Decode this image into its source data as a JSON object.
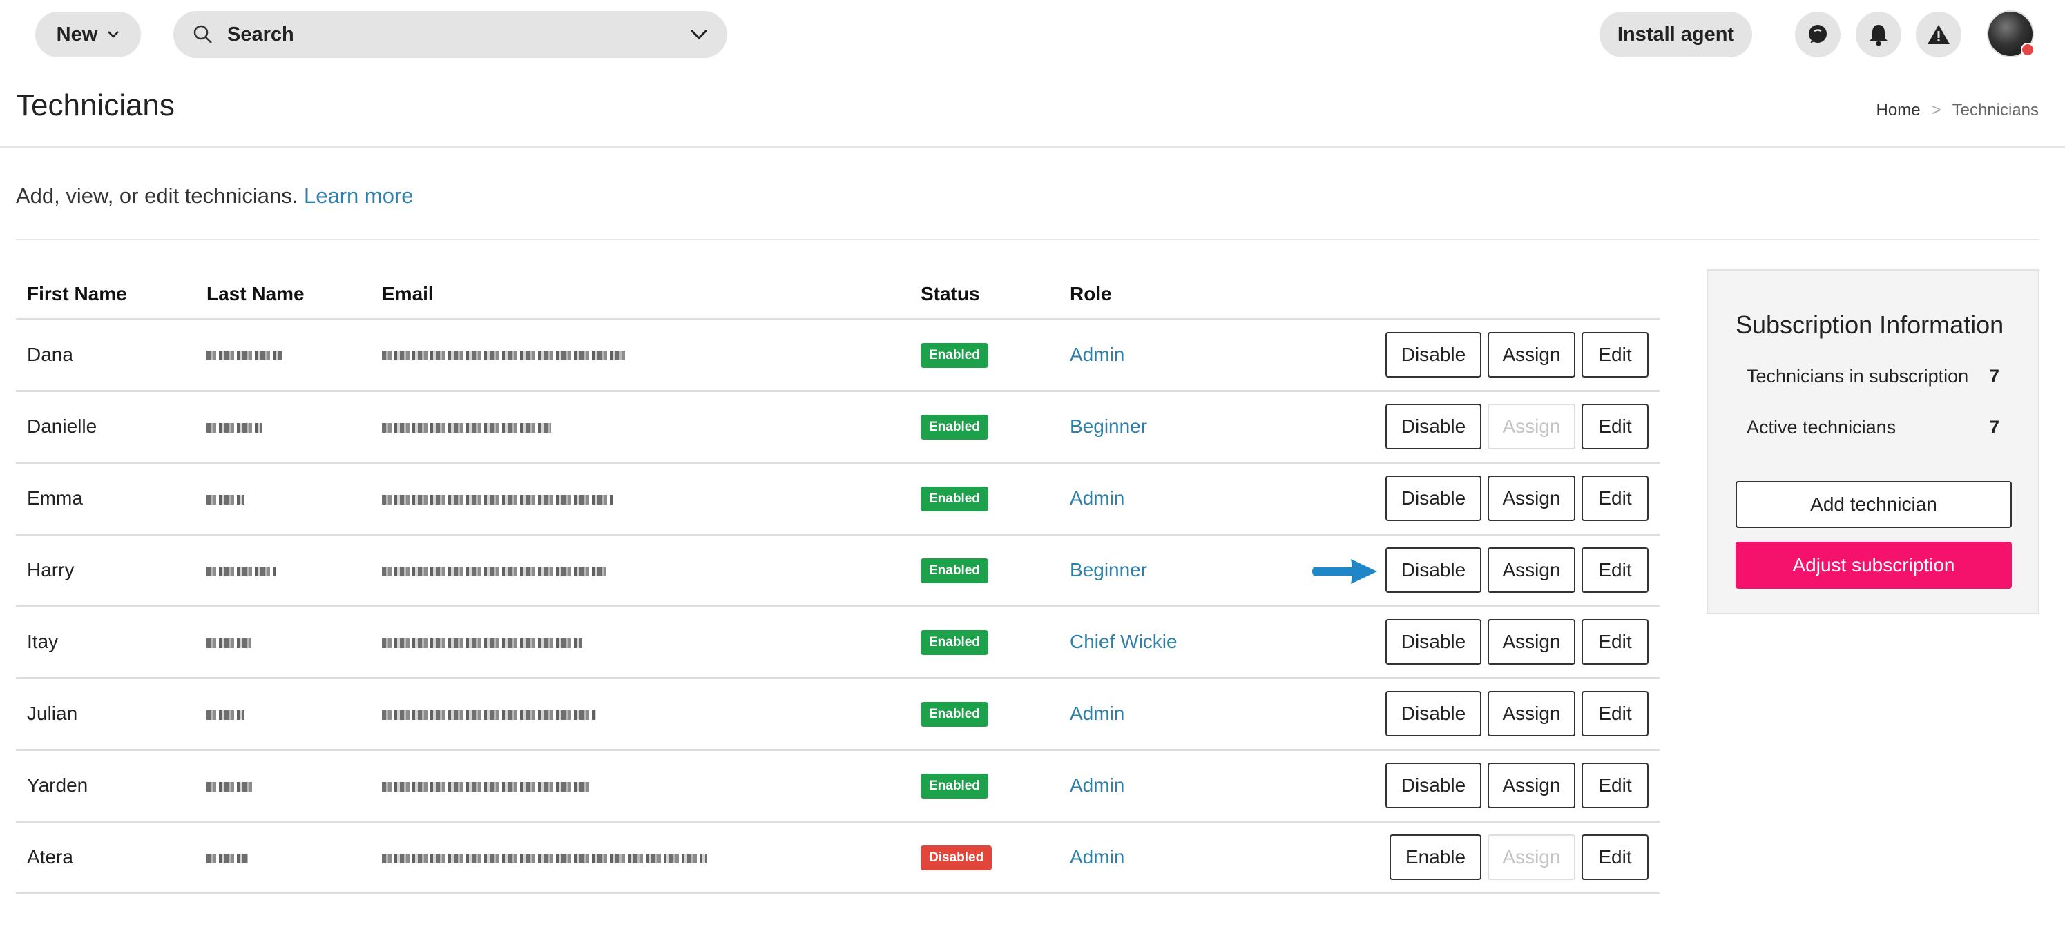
{
  "topbar": {
    "new_label": "New",
    "search_label": "Search",
    "install_label": "Install agent",
    "icons": [
      "chat-icon",
      "bell-icon",
      "alert-icon"
    ]
  },
  "page": {
    "title": "Technicians",
    "breadcrumb": {
      "home": "Home",
      "separator": ">",
      "current": "Technicians"
    },
    "intro_text": "Add, view, or edit technicians.",
    "learn_more": "Learn more"
  },
  "table": {
    "headers": [
      "First Name",
      "Last Name",
      "Email",
      "Status",
      "Role"
    ],
    "rows": [
      {
        "first": "Dana",
        "status": "Enabled",
        "role": "Admin",
        "toggle": "Disable",
        "assign": "Assign",
        "assign_enabled": true,
        "edit": "Edit"
      },
      {
        "first": "Danielle",
        "status": "Enabled",
        "role": "Beginner",
        "toggle": "Disable",
        "assign": "Assign",
        "assign_enabled": false,
        "edit": "Edit"
      },
      {
        "first": "Emma",
        "status": "Enabled",
        "role": "Admin",
        "toggle": "Disable",
        "assign": "Assign",
        "assign_enabled": true,
        "edit": "Edit"
      },
      {
        "first": "Harry",
        "status": "Enabled",
        "role": "Beginner",
        "toggle": "Disable",
        "assign": "Assign",
        "assign_enabled": true,
        "edit": "Edit"
      },
      {
        "first": "Itay",
        "status": "Enabled",
        "role": "Chief Wickie",
        "toggle": "Disable",
        "assign": "Assign",
        "assign_enabled": true,
        "edit": "Edit"
      },
      {
        "first": "Julian",
        "status": "Enabled",
        "role": "Admin",
        "toggle": "Disable",
        "assign": "Assign",
        "assign_enabled": true,
        "edit": "Edit"
      },
      {
        "first": "Yarden",
        "status": "Enabled",
        "role": "Admin",
        "toggle": "Disable",
        "assign": "Assign",
        "assign_enabled": true,
        "edit": "Edit"
      },
      {
        "first": "Atera",
        "status": "Disabled",
        "role": "Admin",
        "toggle": "Enable",
        "assign": "Assign",
        "assign_enabled": false,
        "edit": "Edit"
      }
    ]
  },
  "subscription": {
    "title": "Subscription Information",
    "in_subscription_label": "Technicians in subscription",
    "in_subscription_value": "7",
    "active_label": "Active technicians",
    "active_value": "7",
    "add_label": "Add technician",
    "adjust_label": "Adjust subscription"
  },
  "colors": {
    "accent_link": "#2f7fa8",
    "enabled_badge": "#1ea14b",
    "disabled_badge": "#e2463a",
    "adjust_button": "#f5126d",
    "arrow": "#1f86c8"
  }
}
